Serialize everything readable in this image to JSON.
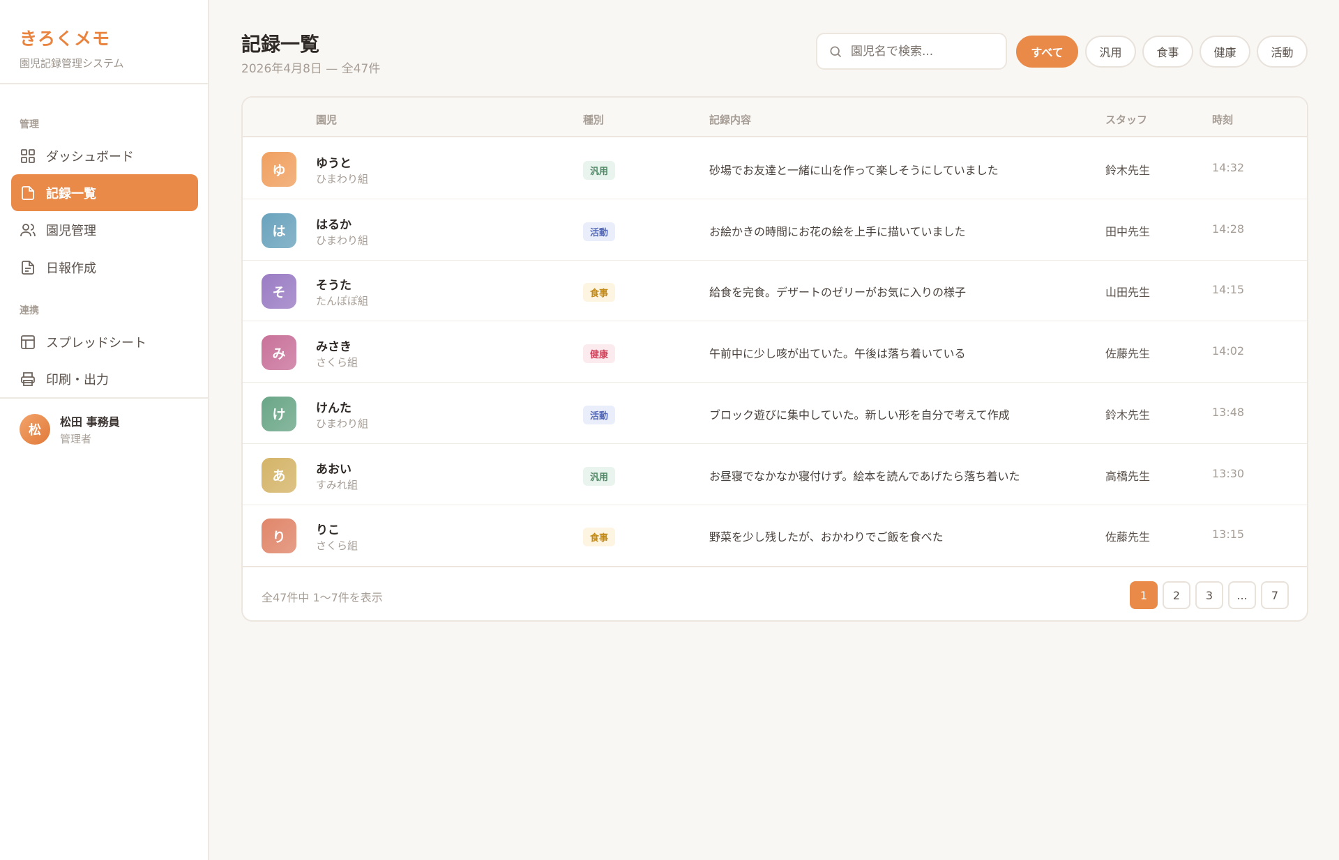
{
  "brand": {
    "title": "きろくメモ",
    "subtitle": "園児記録管理システム"
  },
  "sidebar": {
    "section_manage": "管理",
    "section_link": "連携",
    "items": [
      {
        "label": "ダッシュボード",
        "icon": "grid-icon"
      },
      {
        "label": "記録一覧",
        "icon": "document-icon",
        "active": true
      },
      {
        "label": "園児管理",
        "icon": "users-icon"
      },
      {
        "label": "日報作成",
        "icon": "report-icon"
      },
      {
        "label": "スプレッドシート",
        "icon": "table-icon"
      },
      {
        "label": "印刷・出力",
        "icon": "printer-icon"
      }
    ],
    "user": {
      "initial": "松",
      "name": "松田 事務員",
      "role": "管理者"
    }
  },
  "header": {
    "title": "記録一覧",
    "subtitle": "2026年4月8日 — 全47件",
    "search_placeholder": "園児名で検索...",
    "filters": [
      "すべて",
      "汎用",
      "食事",
      "健康",
      "活動"
    ],
    "active_filter": "すべて"
  },
  "table": {
    "columns": [
      "園児",
      "種別",
      "記録内容",
      "スタッフ",
      "時刻"
    ],
    "rows": [
      {
        "initial": "ゆ",
        "name": "ゆうと",
        "class": "ひまわり組",
        "type": "汎用",
        "content": "砂場でお友達と一緒に山を作って楽しそうにしていました",
        "staff": "鈴木先生",
        "time": "14:32",
        "color": "#f0a060"
      },
      {
        "initial": "は",
        "name": "はるか",
        "class": "ひまわり組",
        "type": "活動",
        "content": "お絵かきの時間にお花の絵を上手に描いていました",
        "staff": "田中先生",
        "time": "14:28",
        "color": "#6aa3bd"
      },
      {
        "initial": "そ",
        "name": "そうた",
        "class": "たんぽぽ組",
        "type": "食事",
        "content": "給食を完食。デザートのゼリーがお気に入りの様子",
        "staff": "山田先生",
        "time": "14:15",
        "color": "#9a7cc4"
      },
      {
        "initial": "み",
        "name": "みさき",
        "class": "さくら組",
        "type": "健康",
        "content": "午前中に少し咳が出ていた。午後は落ち着いている",
        "staff": "佐藤先生",
        "time": "14:02",
        "color": "#c9729a"
      },
      {
        "initial": "け",
        "name": "けんた",
        "class": "ひまわり組",
        "type": "活動",
        "content": "ブロック遊びに集中していた。新しい形を自分で考えて作成",
        "staff": "鈴木先生",
        "time": "13:48",
        "color": "#6aa687"
      },
      {
        "initial": "あ",
        "name": "あおい",
        "class": "すみれ組",
        "type": "汎用",
        "content": "お昼寝でなかなか寝付けず。絵本を読んであげたら落ち着いた",
        "staff": "高橋先生",
        "time": "13:30",
        "color": "#d4b468"
      },
      {
        "initial": "り",
        "name": "りこ",
        "class": "さくら組",
        "type": "食事",
        "content": "野菜を少し残したが、おかわりでご飯を食べた",
        "staff": "佐藤先生",
        "time": "13:15",
        "color": "#e0866a"
      }
    ],
    "footer": "全47件中 1〜7件を表示",
    "pages": [
      "1",
      "2",
      "3",
      "...",
      "7"
    ],
    "current_page": "1"
  },
  "colors": {
    "accent": "#ea8a49"
  }
}
